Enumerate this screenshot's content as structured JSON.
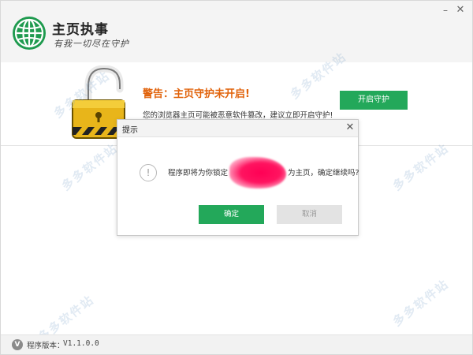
{
  "app": {
    "title": "主页执事",
    "slogan": "有我一切尽在守护",
    "brand_color": "#23a85a"
  },
  "window_controls": {
    "minimize": "–",
    "close": "✕"
  },
  "warning": {
    "title": "警告：主页守护未开启!",
    "description": "您的浏览器主页可能被恶意软件篡改，建议立即开启守护!",
    "button_label": "开启守护",
    "title_color": "#e1620a"
  },
  "dialog": {
    "title": "提示",
    "close": "✕",
    "info_icon": "!",
    "message_prefix": "程序即将为你锁定",
    "message_suffix": "为主页，确定继续吗?",
    "ok_label": "确定",
    "cancel_label": "取消"
  },
  "footer": {
    "version_icon": "V",
    "version_label": "程序版本：",
    "version_value": "V1.1.0.0"
  },
  "watermark": {
    "text": "多多软件站"
  }
}
